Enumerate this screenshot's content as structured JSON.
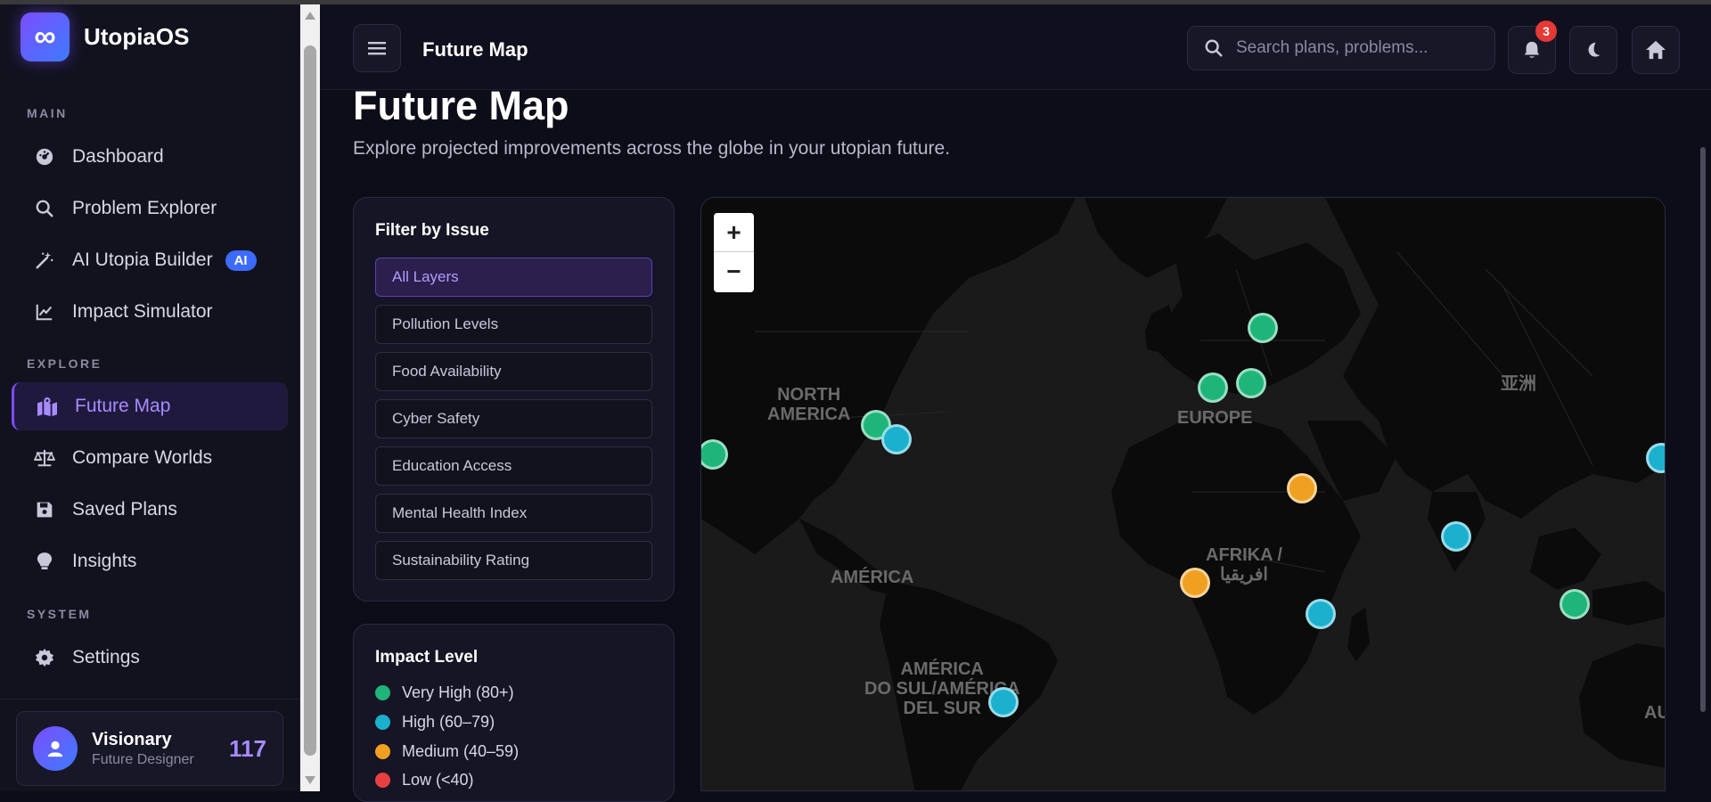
{
  "app": {
    "name": "UtopiaOS",
    "logo_glyph": "∞"
  },
  "sidebar": {
    "sections": [
      {
        "label": "MAIN"
      },
      {
        "label": "EXPLORE"
      },
      {
        "label": "SYSTEM"
      }
    ],
    "items": [
      {
        "label": "Dashboard",
        "icon": "gauge-icon"
      },
      {
        "label": "Problem Explorer",
        "icon": "search-icon"
      },
      {
        "label": "AI Utopia Builder",
        "icon": "magic-wand-icon",
        "badge": "AI"
      },
      {
        "label": "Impact Simulator",
        "icon": "line-chart-icon"
      },
      {
        "label": "Future Map",
        "icon": "map-icon",
        "active": true
      },
      {
        "label": "Compare Worlds",
        "icon": "scale-icon"
      },
      {
        "label": "Saved Plans",
        "icon": "floppy-disk-icon"
      },
      {
        "label": "Insights",
        "icon": "lightbulb-icon"
      },
      {
        "label": "Settings",
        "icon": "gear-icon"
      }
    ]
  },
  "user": {
    "name": "Visionary",
    "role": "Future Designer",
    "score": "117"
  },
  "topbar": {
    "title": "Future Map",
    "search_placeholder": "Search plans, problems...",
    "notification_count": "3"
  },
  "page": {
    "title": "Future Map",
    "subtitle": "Explore projected improvements across the globe in your utopian future."
  },
  "filter": {
    "title": "Filter by Issue",
    "options": [
      "All Layers",
      "Pollution Levels",
      "Food Availability",
      "Cyber Safety",
      "Education Access",
      "Mental Health Index",
      "Sustainability Rating"
    ],
    "selected": "All Layers"
  },
  "impact": {
    "title": "Impact Level",
    "levels": [
      {
        "label": "Very High (80+)",
        "color": "#1fb57a"
      },
      {
        "label": "High (60–79)",
        "color": "#1cb0cf"
      },
      {
        "label": "Medium (40–59)",
        "color": "#f0a020"
      },
      {
        "label": "Low (<40)",
        "color": "#e84040"
      }
    ]
  },
  "map": {
    "zoom_in": "+",
    "zoom_out": "−",
    "labels": {
      "north_america": "NORTH\nAMERICA",
      "europe": "EUROPE",
      "asia": "亚洲",
      "america": "AMÉRICA",
      "africa": "AFRIKA /\nافريقيا",
      "south_america": "AMÉRICA\nDO SUL/AMÉRICA\nDEL SUR",
      "australia": "AU"
    },
    "marker_colors": {
      "very_high": "#1fb57a",
      "high": "#1cb0cf",
      "medium": "#f0a020"
    }
  }
}
